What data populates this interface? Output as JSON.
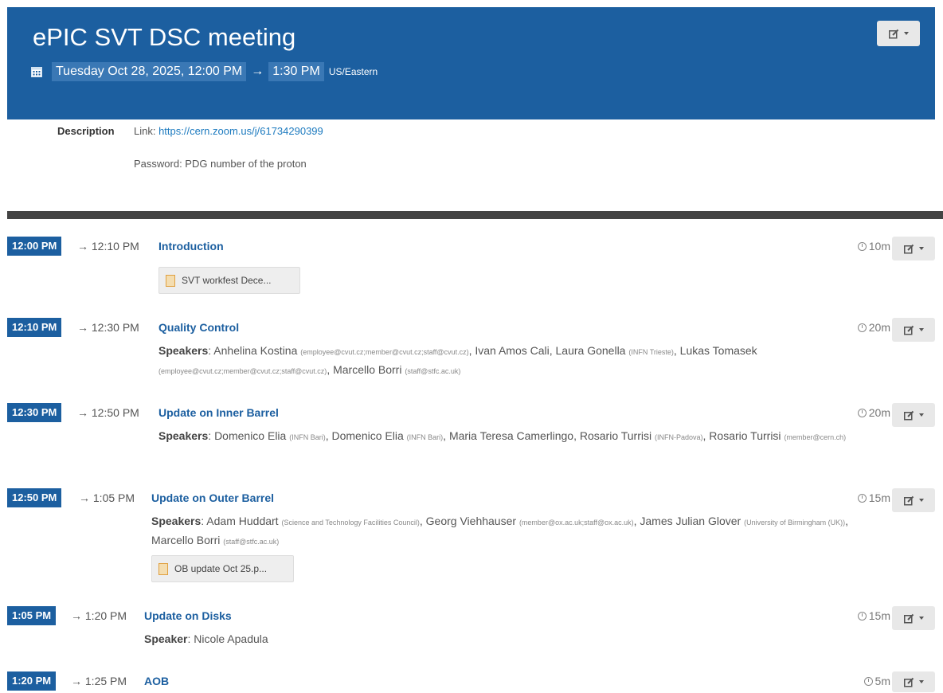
{
  "event": {
    "title": "ePIC SVT DSC meeting",
    "date_start": "Tuesday Oct 28, 2025, 12:00 PM",
    "arrow": "→",
    "time_end": "1:30 PM",
    "timezone": "US/Eastern"
  },
  "description": {
    "label": "Description",
    "link_prefix": "Link: ",
    "link": "https://cern.zoom.us/j/61734290399",
    "password": "Password: PDG number of the proton"
  },
  "icons": {
    "calendar": "calendar-icon",
    "edit": "edit-icon",
    "clock": "clock-icon",
    "file": "file-icon"
  },
  "colors": {
    "header": "#1c5fa0",
    "accent": "#1c5fa0",
    "link": "#1c7abf"
  },
  "entries": [
    {
      "start": "12:00 PM",
      "end": "→ 12:10 PM",
      "title": "Introduction",
      "duration": "10m",
      "attachment": "SVT workfest Dece..."
    },
    {
      "start": "12:10 PM",
      "end": "→ 12:30 PM",
      "title": "Quality Control",
      "duration": "20m",
      "speaker_label": "Speakers",
      "speakers": [
        {
          "name": "Anhelina Kostina",
          "aff": "(employee@cvut.cz;member@cvut.cz;staff@cvut.cz)"
        },
        {
          "name": "Ivan Amos Cali",
          "aff": ""
        },
        {
          "name": "Laura Gonella",
          "aff": "(INFN Trieste)"
        },
        {
          "name": "Lukas Tomasek",
          "aff": "(employee@cvut.cz;member@cvut.cz;staff@cvut.cz)"
        },
        {
          "name": "Marcello Borri",
          "aff": "(staff@stfc.ac.uk)"
        }
      ]
    },
    {
      "start": "12:30 PM",
      "end": "→ 12:50 PM",
      "title": "Update on Inner Barrel",
      "duration": "20m",
      "speaker_label": "Speakers",
      "speakers": [
        {
          "name": "Domenico Elia",
          "aff": "(INFN Bari)"
        },
        {
          "name": "Domenico Elia",
          "aff": "(INFN Bari)"
        },
        {
          "name": "Maria Teresa Camerlingo",
          "aff": ""
        },
        {
          "name": "Rosario Turrisi",
          "aff": "(INFN-Padova)"
        },
        {
          "name": "Rosario Turrisi",
          "aff": "(member@cern.ch)"
        }
      ]
    },
    {
      "start": "12:50 PM",
      "end": "→ 1:05 PM",
      "title": "Update on Outer Barrel",
      "duration": "15m",
      "speaker_label": "Speakers",
      "speakers": [
        {
          "name": "Adam Huddart",
          "aff": "(Science and Technology Facilities Council)"
        },
        {
          "name": "Georg Viehhauser",
          "aff": "(member@ox.ac.uk;staff@ox.ac.uk)"
        },
        {
          "name": "James Julian Glover",
          "aff": "(University of Birmingham (UK))"
        },
        {
          "name": "Marcello Borri",
          "aff": "(staff@stfc.ac.uk)"
        }
      ],
      "attachment": "OB update Oct 25.p..."
    },
    {
      "start": "1:05 PM",
      "end": "→ 1:20 PM",
      "title": "Update on Disks",
      "duration": "15m",
      "speaker_label": "Speaker",
      "speakers": [
        {
          "name": "Nicole Apadula",
          "aff": ""
        }
      ]
    },
    {
      "start": "1:20 PM",
      "end": "→ 1:25 PM",
      "title": "AOB",
      "duration": "5m"
    }
  ]
}
